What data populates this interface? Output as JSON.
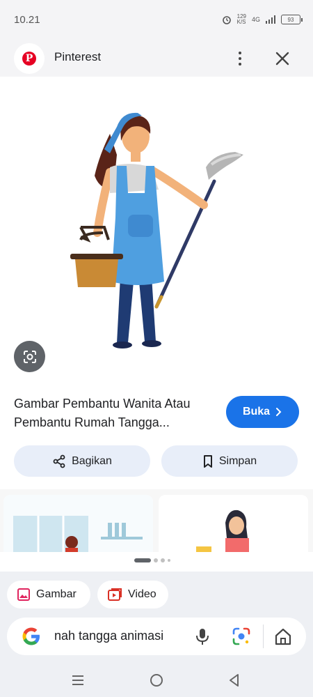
{
  "status_bar": {
    "time": "10.21",
    "net_speed_value": "129",
    "net_speed_unit": "K/S",
    "network": "4G",
    "battery": "93",
    "icons": [
      "alarm-icon",
      "signal-icon",
      "battery-icon"
    ]
  },
  "header": {
    "source_name": "Pinterest",
    "logo_letter": "P",
    "icons": [
      "more-vert-icon",
      "close-icon"
    ]
  },
  "image": {
    "lens_icon": "lens-icon"
  },
  "result": {
    "title": "Gambar Pembantu Wanita Atau Pembantu Rumah Tangga...",
    "open_label": "Buka",
    "share_label": "Bagikan",
    "save_label": "Simpan"
  },
  "pager": {
    "pages": 4,
    "active": 1
  },
  "chips": [
    {
      "label": "Gambar",
      "icon": "image-icon"
    },
    {
      "label": "Video",
      "icon": "video-icon"
    }
  ],
  "search": {
    "query": "nah tangga animasi",
    "icons": [
      "google-icon",
      "mic-icon",
      "lens-icon",
      "home-icon"
    ]
  },
  "nav": {
    "icons": [
      "recents-icon",
      "home-circle-icon",
      "back-icon"
    ]
  },
  "colors": {
    "accent": "#1a73e8",
    "pinterest": "#e60023",
    "pill_bg": "#e8eef9",
    "panel_bg": "#eef0f4"
  }
}
